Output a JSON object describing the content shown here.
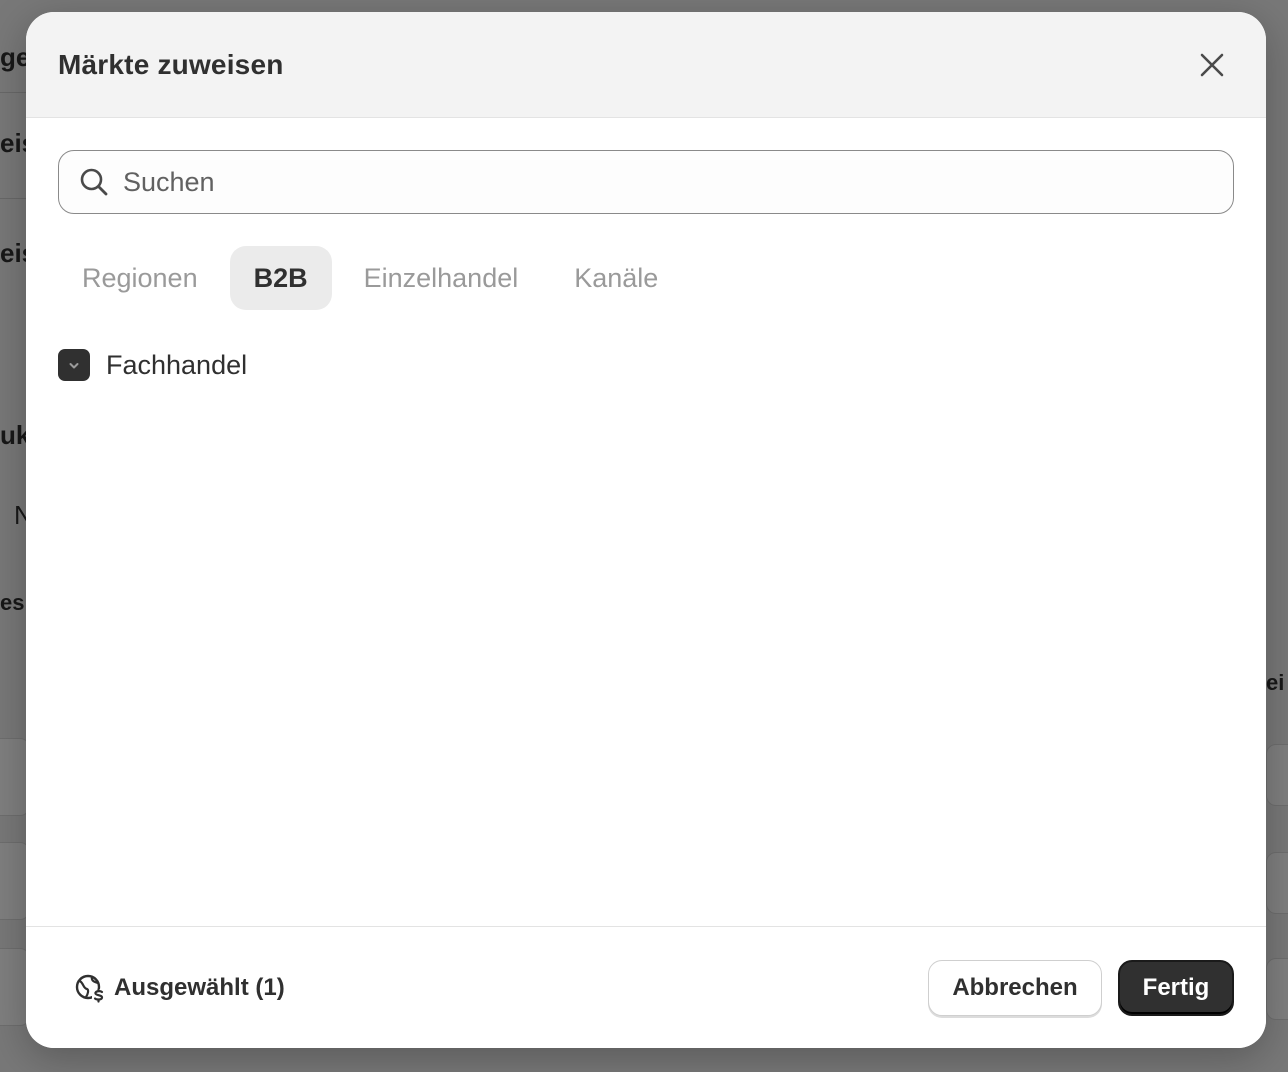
{
  "dialog": {
    "title": "Märkte zuweisen",
    "close_icon": "close-icon"
  },
  "search": {
    "placeholder": "Suchen",
    "value": ""
  },
  "tabs": [
    {
      "label": "Regionen",
      "active": false
    },
    {
      "label": "B2B",
      "active": true
    },
    {
      "label": "Einzelhandel",
      "active": false
    },
    {
      "label": "Kanäle",
      "active": false
    }
  ],
  "list": [
    {
      "label": "Fachhandel",
      "checked": true
    }
  ],
  "footer": {
    "selected_label": "Ausgewählt (1)",
    "selected_icon": "globe-currency-icon",
    "cancel_label": "Abbrechen",
    "done_label": "Fertig"
  },
  "colors": {
    "primary": "#303030",
    "header_bg": "#f3f3f3",
    "active_tab_bg": "#ebebeb"
  }
}
